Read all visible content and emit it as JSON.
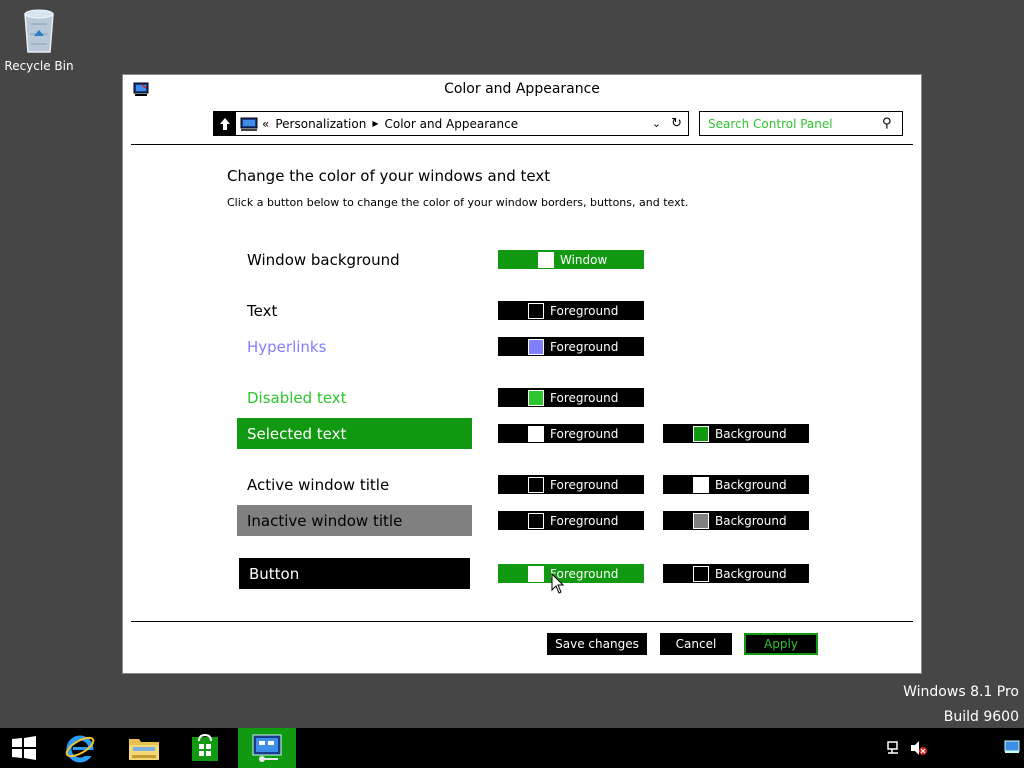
{
  "desktop": {
    "recycle_bin": "Recycle Bin",
    "watermark_line1": "Windows 8.1 Pro",
    "watermark_line2": "Build 9600"
  },
  "window": {
    "title": "Color and Appearance",
    "address": {
      "overflow": "«",
      "crumbs": [
        "Personalization",
        "Color and Appearance"
      ]
    },
    "search_placeholder": "Search Control Panel",
    "heading": "Change the color of your windows and text",
    "subheading": "Click a button below to change the color of your window borders, buttons, and text.",
    "rows": [
      {
        "label": "Window background",
        "label_color": "#000000",
        "label_bg": "",
        "fg": {
          "text": "Window",
          "bar": "#119a11",
          "chip": "#ffffff"
        }
      },
      {
        "label": "Text",
        "label_color": "#000000",
        "label_bg": "",
        "fg": {
          "text": "Foreground",
          "bar": "#000000",
          "chip": "#000000"
        }
      },
      {
        "label": "Hyperlinks",
        "label_color": "#8080ff",
        "label_bg": "",
        "fg": {
          "text": "Foreground",
          "bar": "#000000",
          "chip": "#8080ff"
        }
      },
      {
        "label": "Disabled text",
        "label_color": "#2ec52e",
        "label_bg": "",
        "fg": {
          "text": "Foreground",
          "bar": "#000000",
          "chip": "#2ec52e"
        }
      },
      {
        "label": "Selected text",
        "label_color": "#ffffff",
        "label_bg": "#119a11",
        "fg": {
          "text": "Foreground",
          "bar": "#000000",
          "chip": "#ffffff"
        },
        "bg": {
          "text": "Background",
          "chip": "#119a11"
        }
      },
      {
        "label": "Active window title",
        "label_color": "#000000",
        "label_bg": "",
        "fg": {
          "text": "Foreground",
          "bar": "#000000",
          "chip": "#000000"
        },
        "bg": {
          "text": "Background",
          "chip": "#ffffff"
        }
      },
      {
        "label": "Inactive window title",
        "label_color": "#000000",
        "label_bg": "#808080",
        "fg": {
          "text": "Foreground",
          "bar": "#000000",
          "chip": "#000000"
        },
        "bg": {
          "text": "Background",
          "chip": "#808080"
        }
      },
      {
        "label": "Button",
        "label_color": "#ffffff",
        "label_bg": "#000000",
        "fg": {
          "text": "Foreground",
          "bar": "#119a11",
          "chip": "#ffffff"
        },
        "bg": {
          "text": "Background",
          "chip": "#000000"
        }
      }
    ],
    "buttons": {
      "save": "Save changes",
      "cancel": "Cancel",
      "apply": "Apply"
    }
  },
  "colors": {
    "accent_green": "#119a11",
    "bright_green": "#2ec52e",
    "hyperlink": "#8080ff",
    "desktop": "#464646"
  },
  "taskbar": {
    "items": [
      "start-icon",
      "internet-explorer-icon",
      "file-explorer-icon",
      "store-icon",
      "control-panel-icon"
    ],
    "tray": [
      "network-icon",
      "volume-muted-icon",
      "show-desktop-icon"
    ]
  }
}
